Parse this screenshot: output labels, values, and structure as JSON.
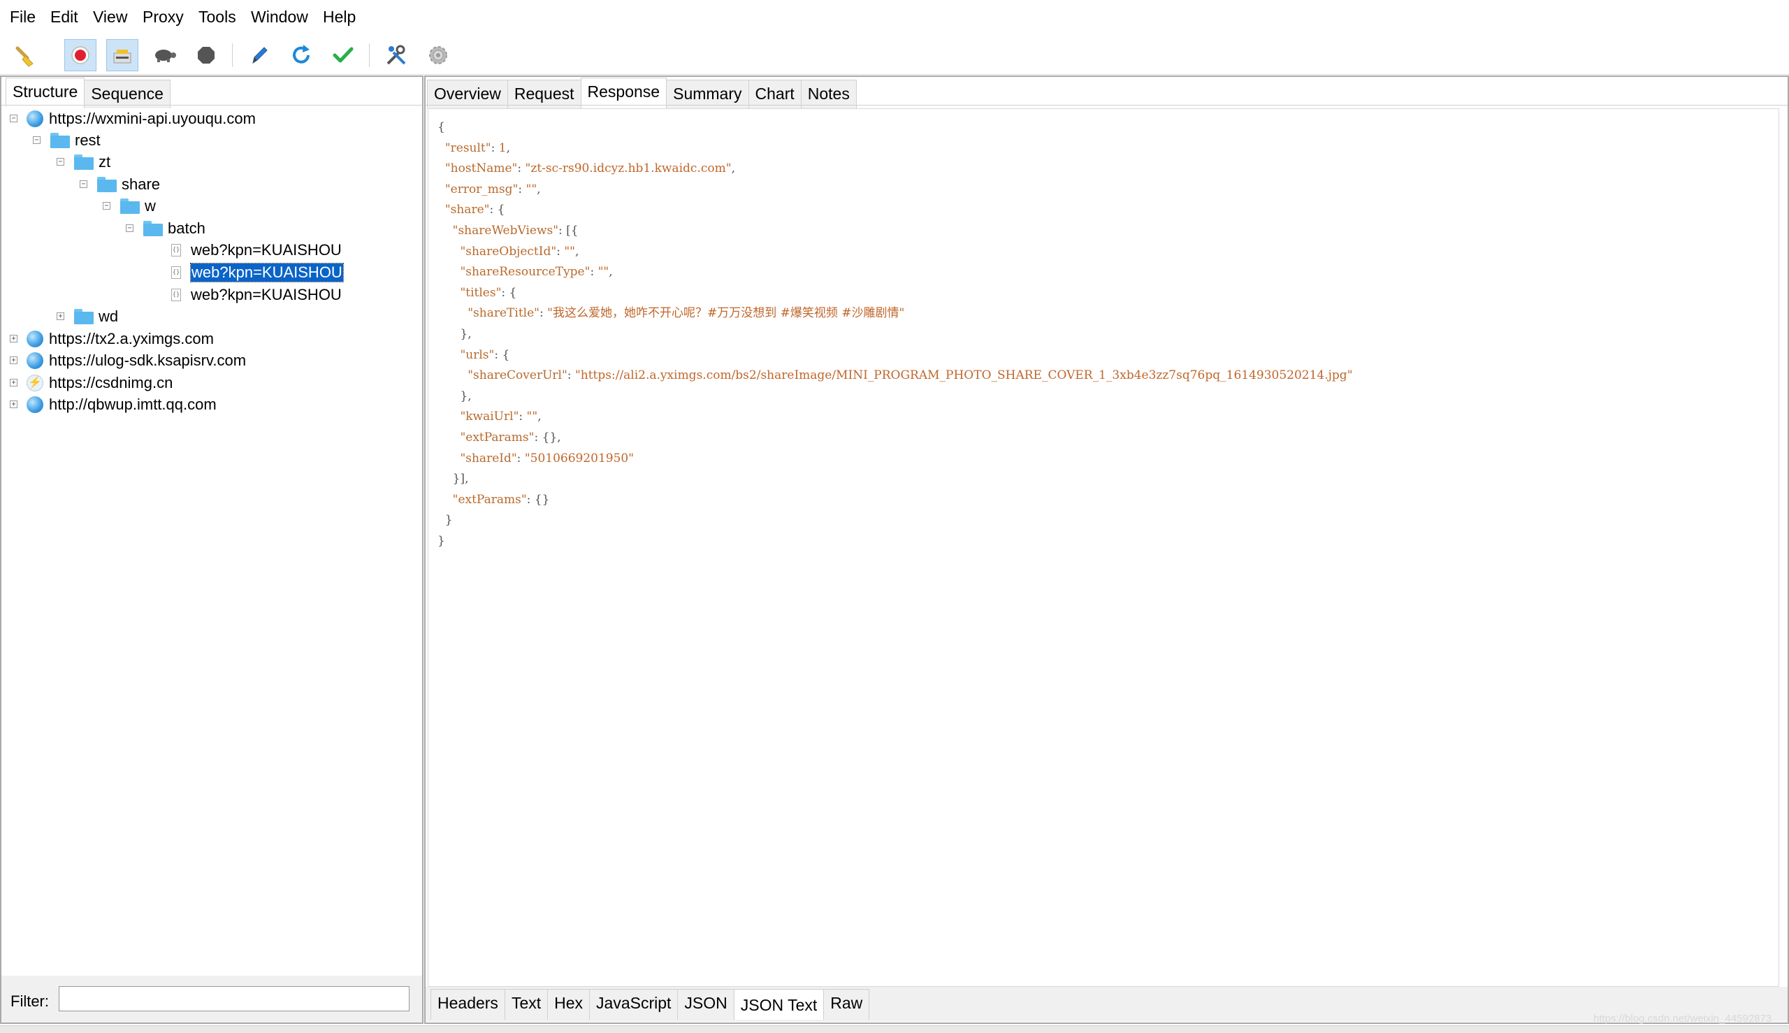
{
  "menu": [
    "File",
    "Edit",
    "View",
    "Proxy",
    "Tools",
    "Window",
    "Help"
  ],
  "toolbar": {
    "buttons": [
      "broom-icon",
      "record-icon",
      "throttle-icon",
      "turtle-icon",
      "stop-icon",
      "pen-icon",
      "refresh-icon",
      "check-icon",
      "tools-icon",
      "settings-icon"
    ]
  },
  "left_tabs": {
    "structure": "Structure",
    "sequence": "Sequence"
  },
  "tree": {
    "host1": "https://wxmini-api.uyouqu.com",
    "rest": "rest",
    "zt": "zt",
    "share": "share",
    "w": "w",
    "batch": "batch",
    "req1": "web?kpn=KUAISHOU",
    "req2": "web?kpn=KUAISHOU",
    "req3": "web?kpn=KUAISHOU",
    "wd": "wd",
    "host2": "https://tx2.a.yximgs.com",
    "host3": "https://ulog-sdk.ksapisrv.com",
    "host4": "https://csdnimg.cn",
    "host5": "http://qbwup.imtt.qq.com"
  },
  "filter": {
    "label": "Filter:",
    "value": ""
  },
  "top_tabs": {
    "overview": "Overview",
    "request": "Request",
    "response": "Response",
    "summary": "Summary",
    "chart": "Chart",
    "notes": "Notes"
  },
  "bottom_tabs": {
    "headers": "Headers",
    "text": "Text",
    "hex": "Hex",
    "javascript": "JavaScript",
    "json": "JSON",
    "json_text": "JSON Text",
    "raw": "Raw"
  },
  "json": {
    "result": "1",
    "hostName": "zt-sc-rs90.idcyz.hb1.kwaidc.com",
    "error_msg": "",
    "shareObjectId": "",
    "shareResourceType": "",
    "shareTitle": "我这么爱她，她咋不开心呢？#万万没想到 #爆笑视频 #沙雕剧情",
    "shareCoverUrl": "https://ali2.a.yximgs.com/bs2/shareImage/MINI_PROGRAM_PHOTO_SHARE_COVER_1_3xb4e3zz7sq76pq_1614930520214.jpg",
    "kwaiUrl": "",
    "shareId": "5010669201950"
  },
  "watermark": "https://blog.csdn.net/weixin_44592873"
}
